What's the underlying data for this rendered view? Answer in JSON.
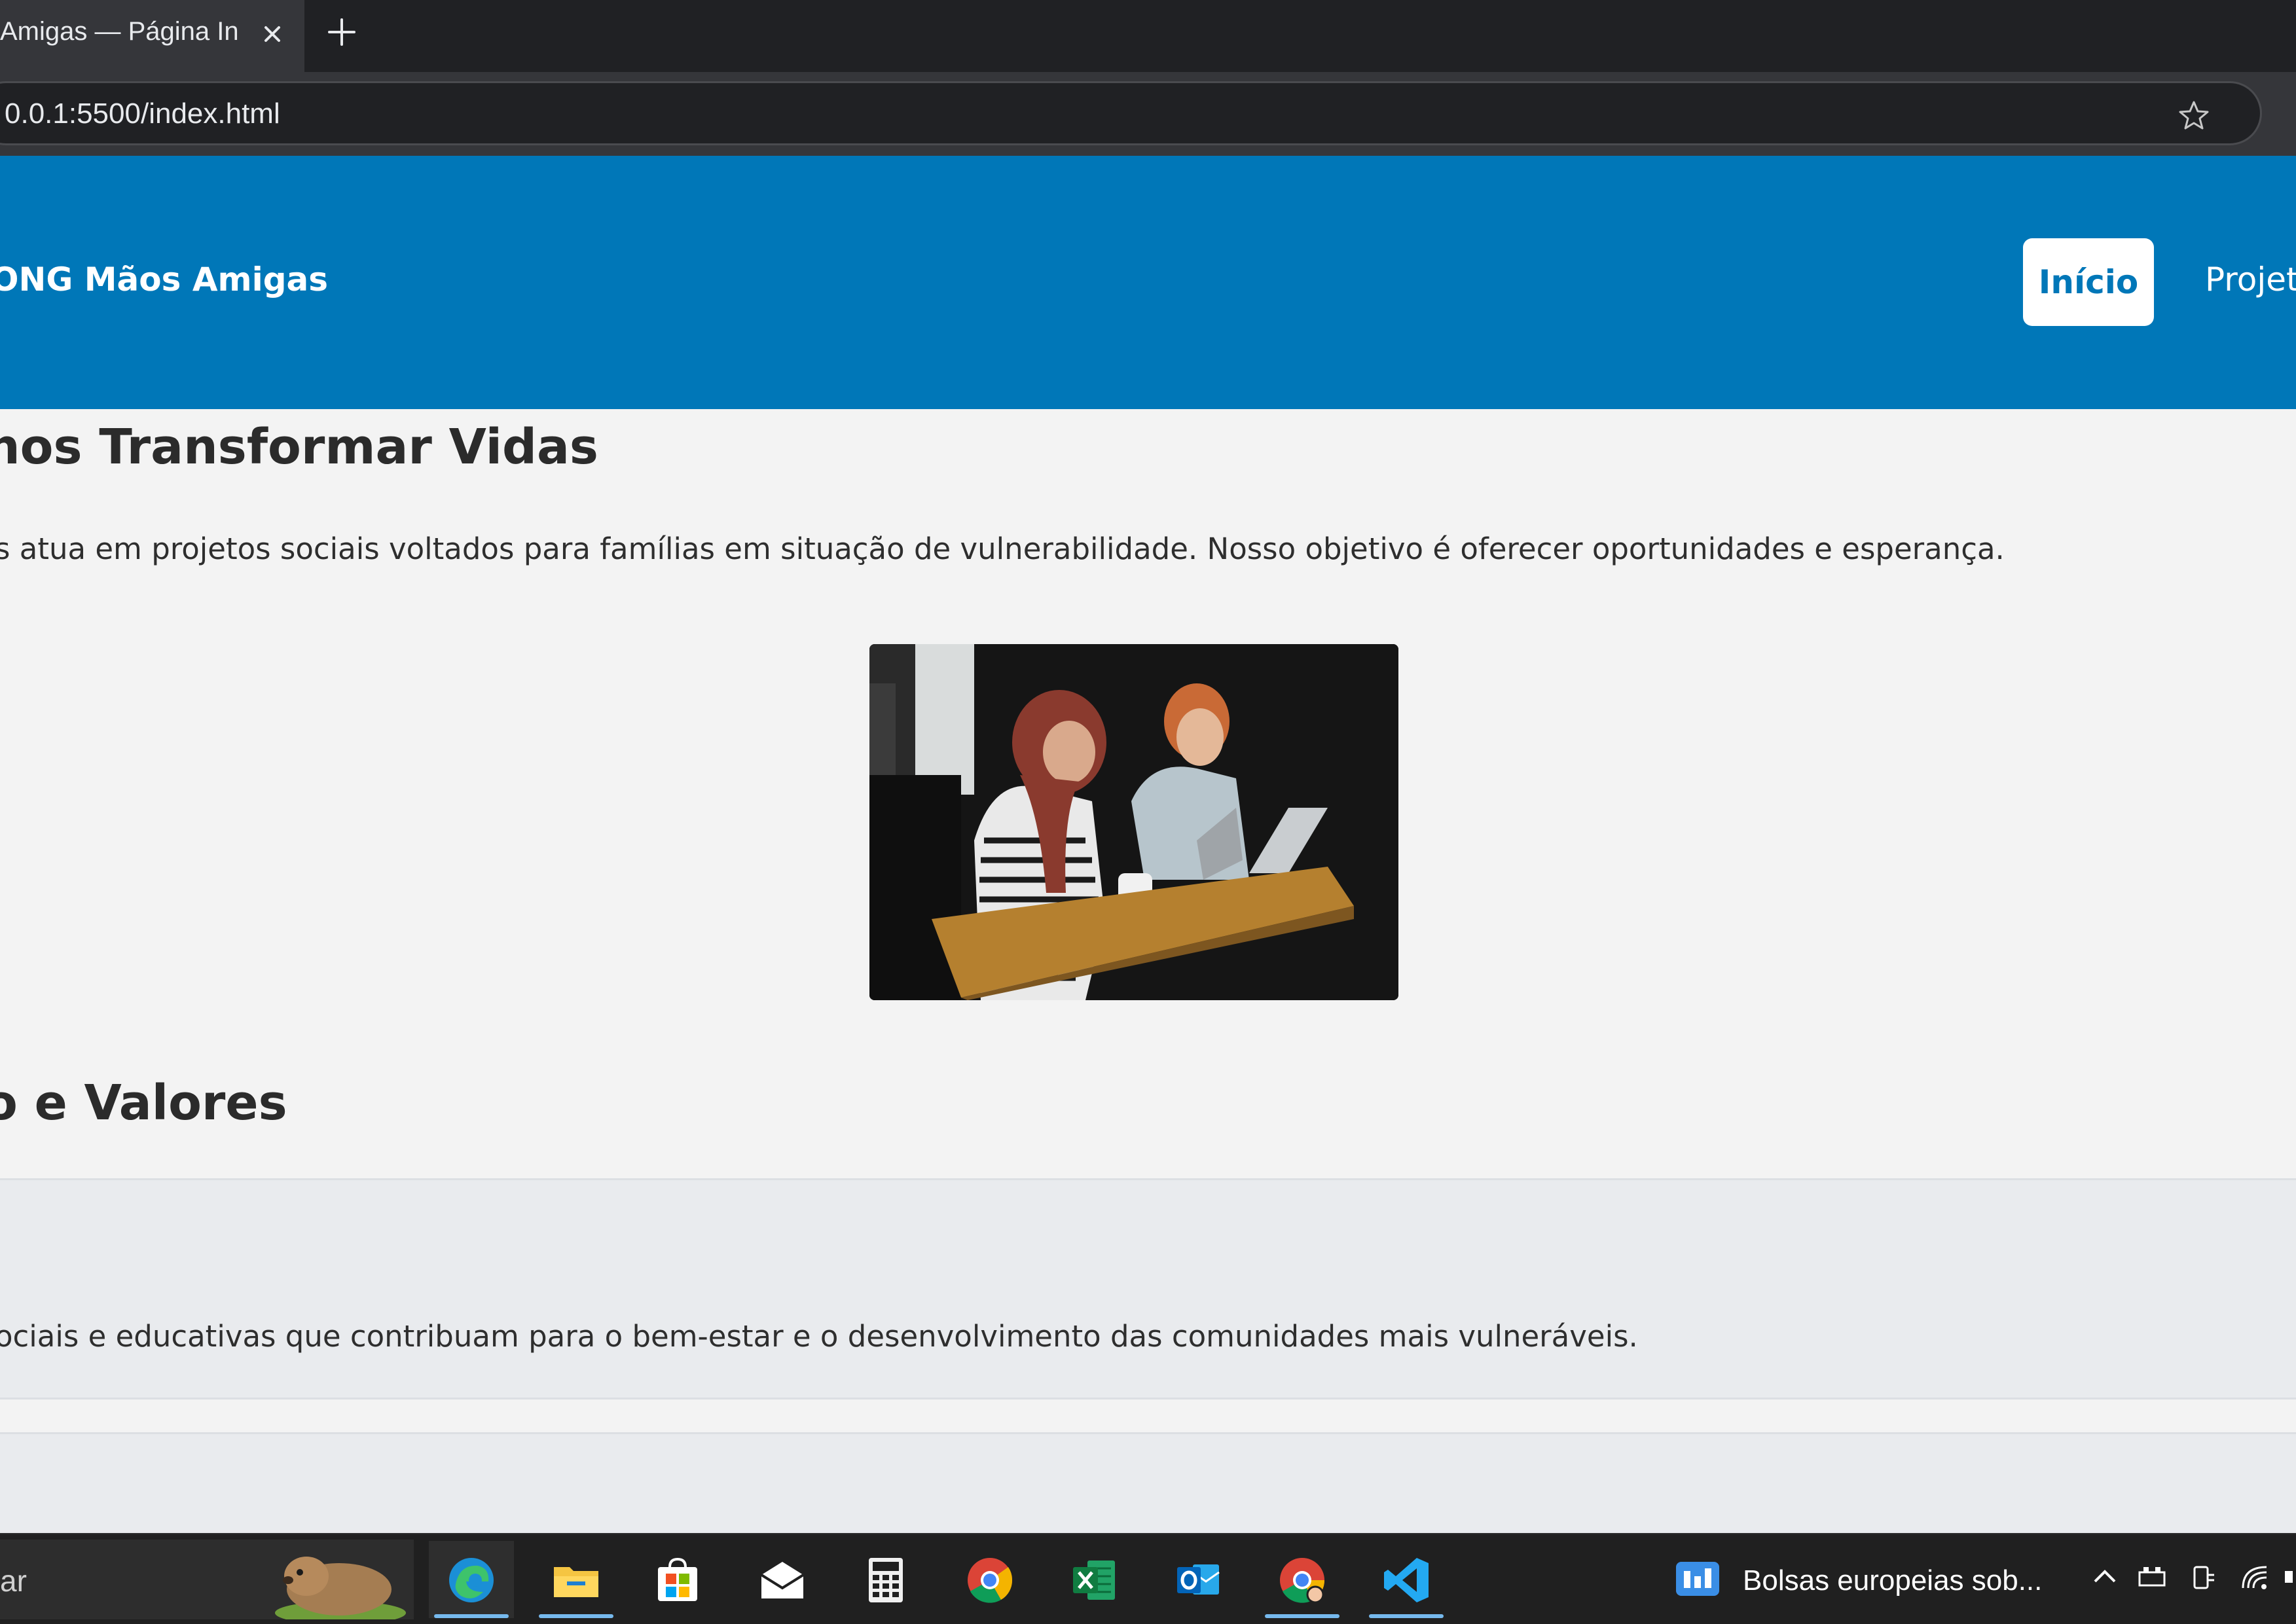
{
  "browser": {
    "tab_title": "Amigas — Página Inic",
    "url": "0.0.1:5500/index.html"
  },
  "header": {
    "brand": "ONG Mãos Amigas",
    "nav_active": "Início",
    "nav_next": "Projeto"
  },
  "hero": {
    "heading": "nos Transformar Vidas",
    "text": "s atua em projetos sociais voltados para famílias em situação de vulnerabilidade. Nosso objetivo é oferecer oportunidades e esperança."
  },
  "values": {
    "heading": "o e Valores",
    "card_text": "ociais e educativas que contribuam para o bem-estar e o desenvolvimento das comunidades mais vulneráveis."
  },
  "taskbar": {
    "search_text": "ar",
    "apps": [
      "edge-icon",
      "file-explorer-icon",
      "microsoft-store-icon",
      "mail-icon",
      "calculator-icon",
      "chrome-icon",
      "excel-icon",
      "outlook-icon",
      "chrome-profile-icon",
      "vscode-icon"
    ],
    "news_text": "Bolsas europeias sob..."
  },
  "colors": {
    "header_blue": "#0077b8",
    "page_bg": "#f3f3f3",
    "card_bg": "#e9ebee"
  }
}
